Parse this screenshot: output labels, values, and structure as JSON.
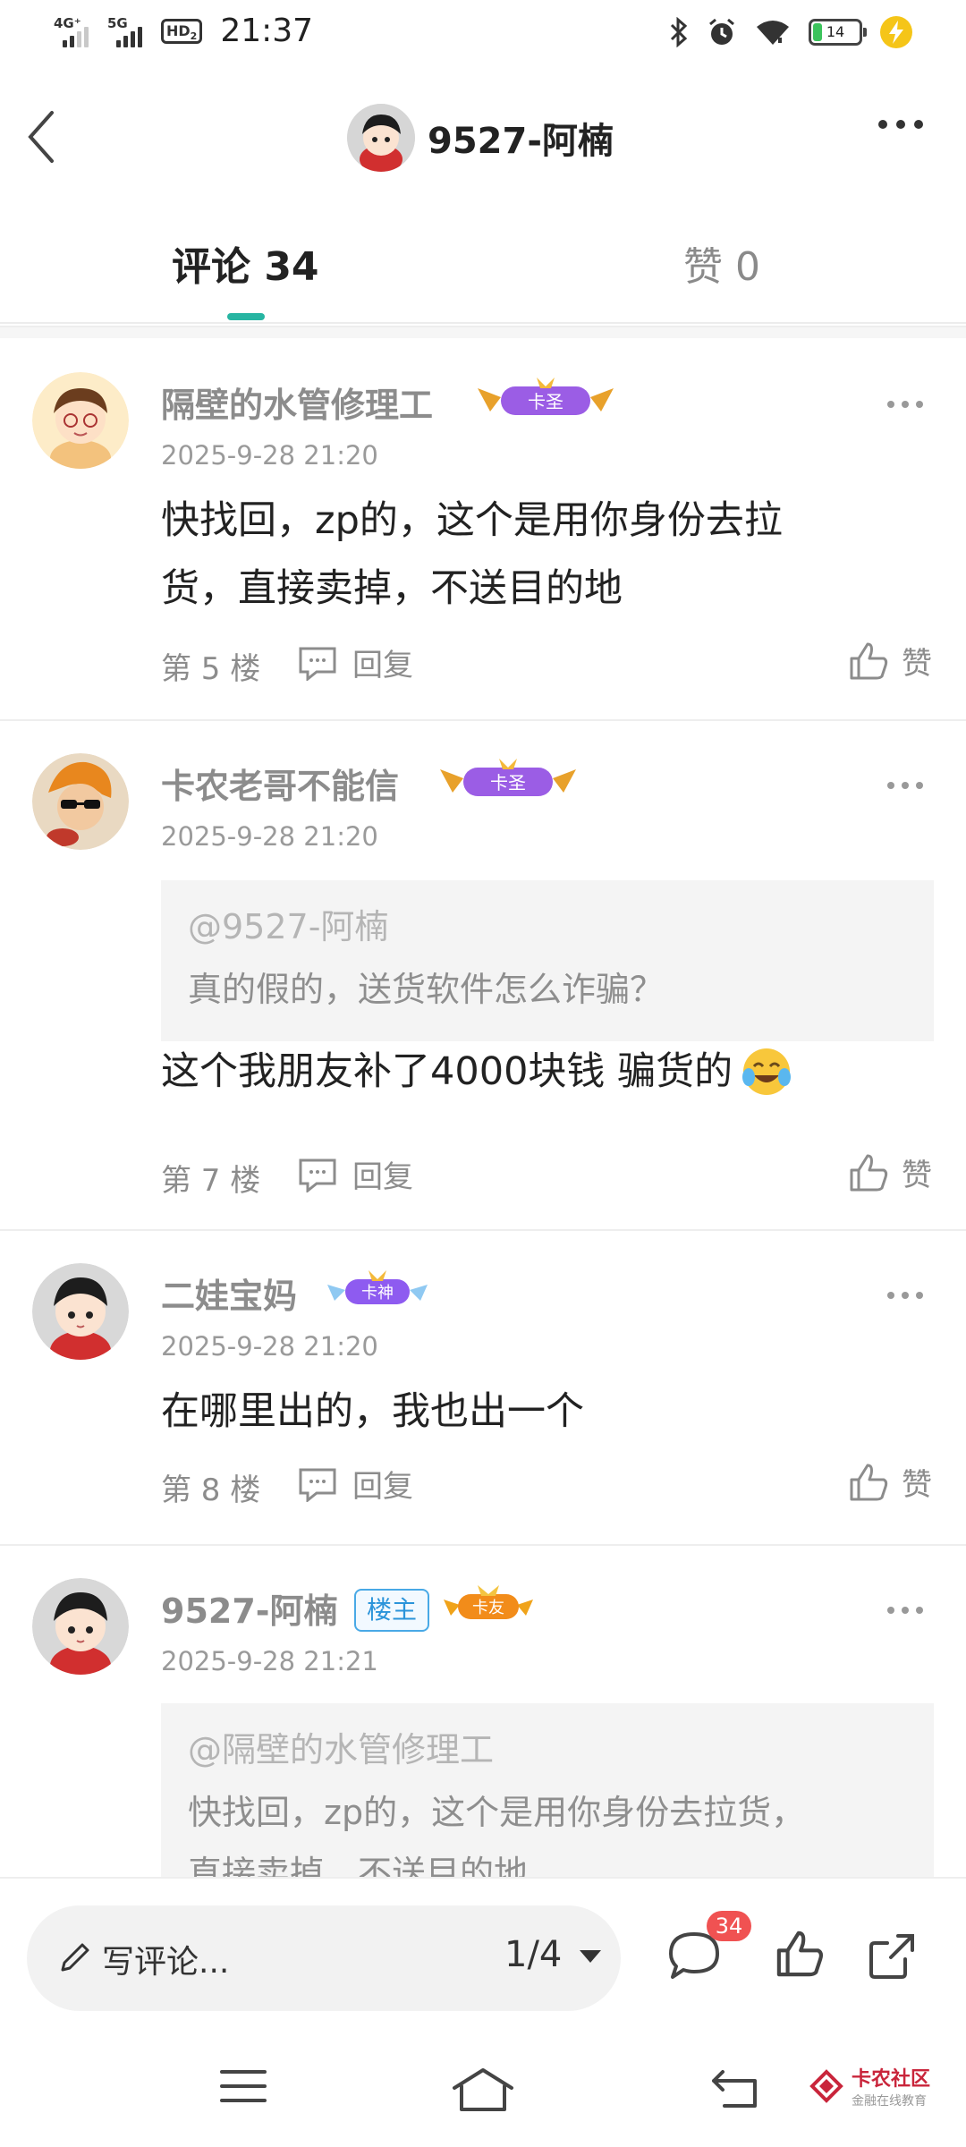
{
  "status_bar": {
    "net1": "4G⁺",
    "net2": "5G",
    "hd": "HD",
    "hd_sub": "2",
    "time": "21:37",
    "battery": "14",
    "icons": [
      "bluetooth-icon",
      "alarm-icon",
      "wifi-icon",
      "battery-icon",
      "charging-icon"
    ]
  },
  "header": {
    "title": "9527-阿楠"
  },
  "tabs": {
    "comments": "评论 34",
    "likes": "赞 0"
  },
  "comments": [
    {
      "user": "隔壁的水管修理工",
      "badge": "卡圣",
      "time": "2025-9-28 21:20",
      "content_lines": [
        "快找回，zp的，这个是用你身份去拉",
        "货，直接卖掉，不送目的地"
      ],
      "floor": "第 5 楼",
      "reply": "回复",
      "like": "赞"
    },
    {
      "user": "卡农老哥不能信",
      "badge": "卡圣",
      "time": "2025-9-28 21:20",
      "quote_user": "@9527-阿楠",
      "quote_text": "真的假的，送货软件怎么诈骗？",
      "content": "这个我朋友补了4000块钱 骗货的",
      "floor": "第 7 楼",
      "reply": "回复",
      "like": "赞"
    },
    {
      "user": "二娃宝妈",
      "badge": "卡神",
      "time": "2025-9-28 21:20",
      "content": "在哪里出的，我也出一个",
      "floor": "第 8 楼",
      "reply": "回复",
      "like": "赞"
    },
    {
      "user": "9527-阿楠",
      "tag": "楼主",
      "badge": "卡友",
      "time": "2025-9-28 21:21",
      "quote_user": "@隔壁的水管修理工",
      "quote_lines": [
        "快找回，zp的，这个是用你身份去拉货，",
        "直接卖掉，不送目的地"
      ]
    }
  ],
  "bottom_bar": {
    "placeholder": "写评论...",
    "pager": "1/4",
    "comment_count": "34"
  },
  "watermark": {
    "line1": "卡农社区",
    "line2": "金融在线教育"
  },
  "colors": {
    "accent": "#27b5a2",
    "badge_red": "#f05252",
    "louzhu_blue": "#2b94da"
  }
}
